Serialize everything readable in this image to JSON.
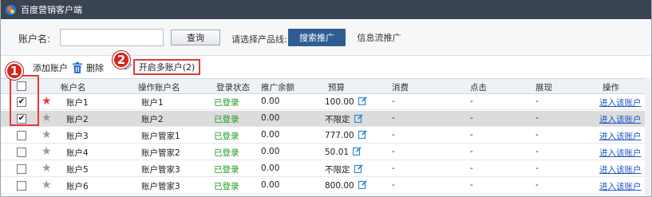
{
  "window": {
    "title": "百度营销客户端"
  },
  "search": {
    "account_label": "账户名:",
    "account_value": "",
    "query_button": "查询",
    "product_label": "请选择产品线:",
    "tabs": [
      "搜索推广",
      "信息流推广"
    ],
    "active_tab": "搜索推广"
  },
  "toolbar": {
    "add_account": "添加账户",
    "delete": "删除",
    "multi_open": "开启多账户(2)"
  },
  "callouts": {
    "one": "1",
    "two": "2"
  },
  "table": {
    "columns": [
      "帐户名",
      "操作账户名",
      "登录状态",
      "推广余额",
      "预算",
      "消费",
      "点击",
      "展现",
      "操作"
    ],
    "rows": [
      {
        "checked": true,
        "starred": true,
        "account": "账户1",
        "operator": "账户1",
        "status": "已登录",
        "balance": "0.00",
        "budget": "100.00",
        "cost": "-",
        "clicks": "-",
        "impressions": "-",
        "action": "进入该账户"
      },
      {
        "checked": true,
        "starred": false,
        "account": "账户2",
        "operator": "账户2",
        "status": "已登录",
        "balance": "0.00",
        "budget": "不限定",
        "cost": "-",
        "clicks": "-",
        "impressions": "-",
        "action": "进入该账户"
      },
      {
        "checked": false,
        "starred": false,
        "account": "账户3",
        "operator": "账户管家1",
        "status": "已登录",
        "balance": "0.00",
        "budget": "777.00",
        "cost": "-",
        "clicks": "-",
        "impressions": "-",
        "action": "进入该账户"
      },
      {
        "checked": false,
        "starred": false,
        "account": "账户4",
        "operator": "账户管家2",
        "status": "已登录",
        "balance": "0.00",
        "budget": "50.01",
        "cost": "-",
        "clicks": "-",
        "impressions": "-",
        "action": "进入该账户"
      },
      {
        "checked": false,
        "starred": false,
        "account": "账户5",
        "operator": "账户管家3",
        "status": "已登录",
        "balance": "0.00",
        "budget": "不限定",
        "cost": "-",
        "clicks": "-",
        "impressions": "-",
        "action": "进入该账户"
      },
      {
        "checked": false,
        "starred": false,
        "account": "账户6",
        "operator": "账户管家3",
        "status": "已登录",
        "balance": "0.00",
        "budget": "800.00",
        "cost": "-",
        "clicks": "-",
        "impressions": "-",
        "action": "进入该账户"
      }
    ]
  },
  "colors": {
    "star_active": "#e53935",
    "star_inactive": "#9a9a9a",
    "status_green": "#1a9b1a",
    "link_blue": "#1b56c7",
    "callout_red": "#d7261e"
  }
}
